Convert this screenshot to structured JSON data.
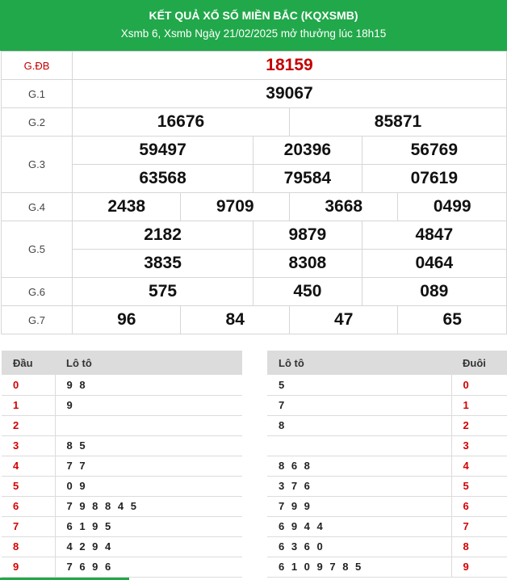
{
  "header": {
    "title": "KẾT QUẢ XỔ SỐ MIỀN BẮC (KQXSMB)",
    "subtitle": "Xsmb 6, Xsmb Ngày 21/02/2025 mở thưởng lúc 18h15"
  },
  "prizes": [
    {
      "label": "G.ĐB",
      "rows": [
        [
          "18159"
        ]
      ]
    },
    {
      "label": "G.1",
      "rows": [
        [
          "39067"
        ]
      ]
    },
    {
      "label": "G.2",
      "rows": [
        [
          "16676",
          "85871"
        ]
      ]
    },
    {
      "label": "G.3",
      "rows": [
        [
          "59497",
          "20396",
          "56769"
        ],
        [
          "63568",
          "79584",
          "07619"
        ]
      ]
    },
    {
      "label": "G.4",
      "rows": [
        [
          "2438",
          "9709",
          "3668",
          "0499"
        ]
      ]
    },
    {
      "label": "G.5",
      "rows": [
        [
          "2182",
          "9879",
          "4847"
        ],
        [
          "3835",
          "8308",
          "0464"
        ]
      ]
    },
    {
      "label": "G.6",
      "rows": [
        [
          "575",
          "450",
          "089"
        ]
      ]
    },
    {
      "label": "G.7",
      "rows": [
        [
          "96",
          "84",
          "47",
          "65"
        ]
      ]
    }
  ],
  "dau_table": {
    "headers": [
      "Đầu",
      "Lô tô"
    ],
    "rows": [
      {
        "key": "0",
        "values": "9 8"
      },
      {
        "key": "1",
        "values": "9"
      },
      {
        "key": "2",
        "values": ""
      },
      {
        "key": "3",
        "values": "8 5"
      },
      {
        "key": "4",
        "values": "7 7"
      },
      {
        "key": "5",
        "values": "0 9"
      },
      {
        "key": "6",
        "values": "7 9 8 8 4 5"
      },
      {
        "key": "7",
        "values": "6 1 9 5"
      },
      {
        "key": "8",
        "values": "4 2 9 4"
      },
      {
        "key": "9",
        "values": "7 6 9 6"
      }
    ]
  },
  "duoi_table": {
    "headers": [
      "Lô tô",
      "Đuôi"
    ],
    "rows": [
      {
        "key": "0",
        "values": "5"
      },
      {
        "key": "1",
        "values": "7"
      },
      {
        "key": "2",
        "values": "8"
      },
      {
        "key": "3",
        "values": ""
      },
      {
        "key": "4",
        "values": "8 6 8"
      },
      {
        "key": "5",
        "values": "3 7 6"
      },
      {
        "key": "6",
        "values": "7 9 9"
      },
      {
        "key": "7",
        "values": "6 9 4 4"
      },
      {
        "key": "8",
        "values": "6 3 6 0"
      },
      {
        "key": "9",
        "values": "6 1 0 9 7 8 5"
      }
    ]
  },
  "colors": {
    "brand_green": "#21a84a",
    "special_red": "#c40000"
  }
}
